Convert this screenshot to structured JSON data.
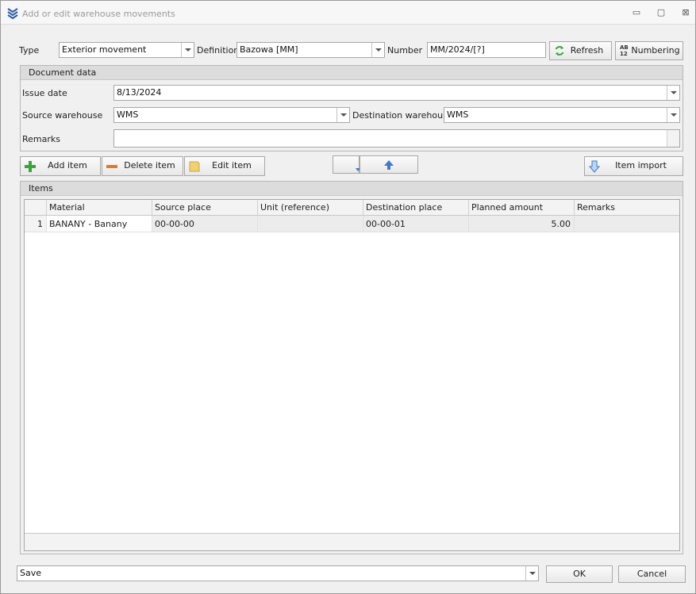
{
  "window": {
    "title": "Add or edit warehouse movements",
    "minimize": "▭",
    "maximize": "▢",
    "close": "⊠"
  },
  "header": {
    "type_label": "Type",
    "type_value": "Exterior movement",
    "definition_label": "Definition",
    "definition_value": "Bazowa [MM]",
    "number_label": "Number",
    "number_value": "MM/2024/[?]",
    "refresh_label": "Refresh",
    "numbering_label": "Numbering"
  },
  "document": {
    "group_title": "Document data",
    "issue_date_label": "Issue date",
    "issue_date_value": "8/13/2024",
    "source_wh_label": "Source warehouse",
    "source_wh_value": "WMS",
    "dest_wh_label": "Destination warehouse",
    "dest_wh_value": "WMS",
    "remarks_label": "Remarks",
    "remarks_value": ""
  },
  "toolbar": {
    "add_item": "Add item",
    "delete_item": "Delete item",
    "edit_item": "Edit item",
    "item_import": "Item import"
  },
  "items": {
    "group_title": "Items",
    "columns": [
      "Material",
      "Source place",
      "Unit (reference)",
      "Destination place",
      "Planned amount",
      "Remarks"
    ],
    "rows": [
      {
        "index": "1",
        "material": "BANANY - Banany",
        "source_place": "00-00-00",
        "unit": "",
        "destination_place": "00-00-01",
        "planned_amount": "5.00",
        "remarks": ""
      }
    ]
  },
  "footer": {
    "action_value": "Save",
    "ok_label": "OK",
    "cancel_label": "Cancel"
  },
  "colors": {
    "add_icon": "#3aa63a",
    "delete_icon": "#e07a2a",
    "edit_icon": "#f0d070",
    "arrow_icon": "#3d7cc9"
  }
}
